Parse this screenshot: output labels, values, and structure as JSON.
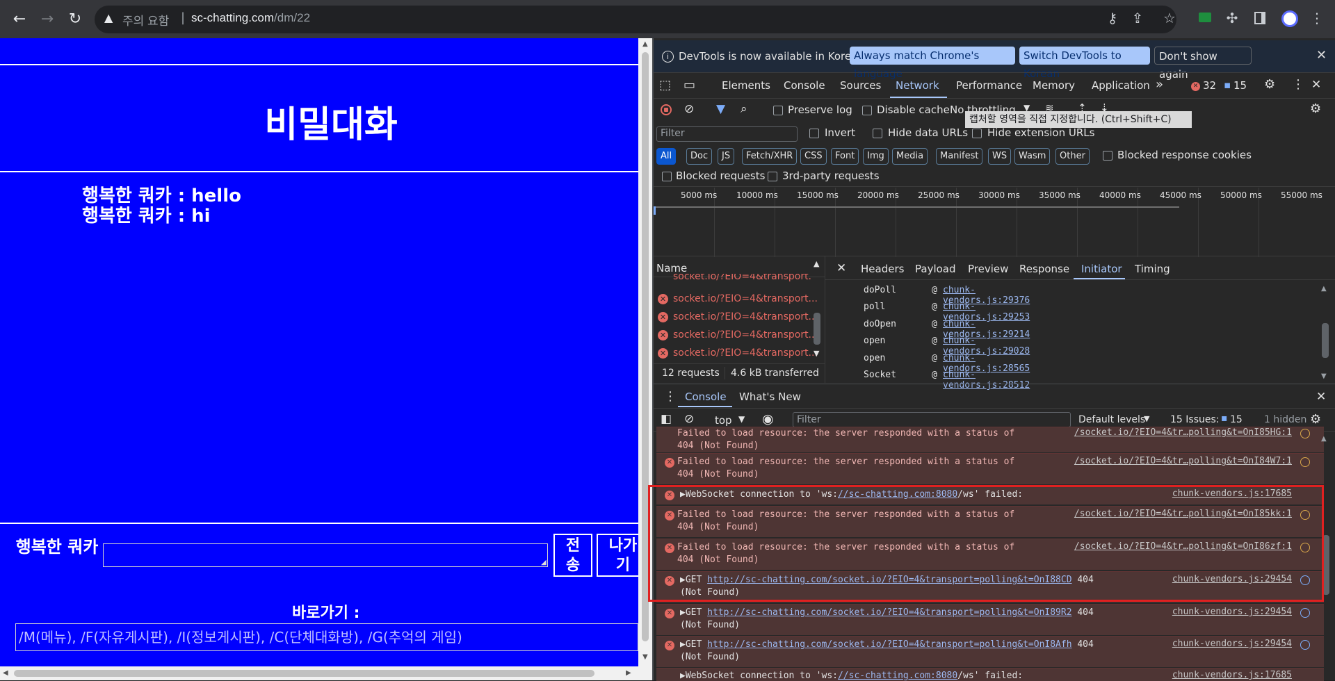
{
  "browser": {
    "security_warning": "주의 요함",
    "url_host": "sc-chatting.com",
    "url_path": "/dm/22"
  },
  "page": {
    "title": "비밀대화",
    "messages": [
      {
        "text": "행복한 쿼카 : hello"
      },
      {
        "text": "행복한 쿼카 : hi"
      }
    ],
    "nickname": "행복한 쿼카",
    "send_label": "전송",
    "exit_label": "나가기",
    "shortcut_label": "바로가기 :",
    "shortcut_text": "/M(메뉴), /F(자유게시판), /I(정보게시판), /C(단체대화방), /G(추억의 게임)"
  },
  "devtools": {
    "infobar": {
      "message": "DevTools is now available in Korean!",
      "btn_match": "Always match Chrome's language",
      "btn_switch": "Switch DevTools to Korean",
      "btn_dismiss": "Don't show again"
    },
    "tabs": [
      "Elements",
      "Console",
      "Sources",
      "Network",
      "Performance",
      "Memory",
      "Application"
    ],
    "error_count": "32",
    "issue_count": "15",
    "toolbar": {
      "preserve_log": "Preserve log",
      "disable_cache": "Disable cache",
      "throttling": "No throttling",
      "tooltip": "캡처할 영역을 직접 지정합니다. (Ctrl+Shift+C)"
    },
    "filter": {
      "placeholder": "Filter",
      "invert": "Invert",
      "hide_data_urls": "Hide data URLs",
      "hide_ext_urls": "Hide extension URLs",
      "blocked_cookies": "Blocked response cookies",
      "blocked_requests": "Blocked requests",
      "third_party": "3rd-party requests"
    },
    "types": [
      "All",
      "Doc",
      "JS",
      "Fetch/XHR",
      "CSS",
      "Font",
      "Img",
      "Media",
      "Manifest",
      "WS",
      "Wasm",
      "Other"
    ],
    "ticks": [
      "5000 ms",
      "10000 ms",
      "15000 ms",
      "20000 ms",
      "25000 ms",
      "30000 ms",
      "35000 ms",
      "40000 ms",
      "45000 ms",
      "50000 ms",
      "55000 ms"
    ],
    "name_header": "Name",
    "requests": [
      "socket.io/?EIO=4&transport...",
      "socket.io/?EIO=4&transport...",
      "socket.io/?EIO=4&transport...",
      "socket.io/?EIO=4&transport...",
      "socket.io/?EIO=4&transport..."
    ],
    "summary_requests": "12 requests",
    "summary_transferred": "4.6 kB transferred",
    "detail_tabs": [
      "Headers",
      "Payload",
      "Preview",
      "Response",
      "Initiator",
      "Timing"
    ],
    "stack": [
      {
        "fn": "doPoll",
        "at": "@",
        "src": "chunk-vendors.js:29376"
      },
      {
        "fn": "poll",
        "at": "@",
        "src": "chunk-vendors.js:29253"
      },
      {
        "fn": "doOpen",
        "at": "@",
        "src": "chunk-vendors.js:29214"
      },
      {
        "fn": "open",
        "at": "@",
        "src": "chunk-vendors.js:29028"
      },
      {
        "fn": "open",
        "at": "@",
        "src": "chunk-vendors.js:28565"
      },
      {
        "fn": "Socket",
        "at": "@",
        "src": "chunk-vendors.js:28512"
      }
    ],
    "drawer_tabs": [
      "Console",
      "What's New"
    ],
    "console_toolbar": {
      "context": "top",
      "filter_placeholder": "Filter",
      "levels": "Default levels",
      "issues_label": "15 Issues:",
      "issues_count": "15",
      "hidden": "1 hidden"
    },
    "console": {
      "r0_l1": "Failed to load resource: the server responded with a status of",
      "r0_l2": "404 (Not Found)",
      "r0_src": "/socket.io/?EIO=4&tr…polling&t=OnI85HG:1",
      "r1_l1": "Failed to load resource: the server responded with a status of",
      "r1_l2": "404 (Not Found)",
      "r1_src": "/socket.io/?EIO=4&tr…polling&t=OnI84W7:1",
      "r2_pre": "▶WebSocket connection to 'ws:",
      "r2_url": "//sc-chatting.com:8080",
      "r2_post": "/ws' failed:",
      "r2_src": "chunk-vendors.js:17685",
      "r3_l1": "Failed to load resource: the server responded with a status of",
      "r3_l2": "404 (Not Found)",
      "r3_src": "/socket.io/?EIO=4&tr…polling&t=OnI85kk:1",
      "r4_l1": "Failed to load resource: the server responded with a status of",
      "r4_l2": "404 (Not Found)",
      "r4_src": "/socket.io/?EIO=4&tr…polling&t=OnI86zf:1",
      "r5_pre": "▶GET ",
      "r5_url": "http://sc-chatting.com/socket.io/?EIO=4&transport=polling&t=OnI88CD",
      "r5_post": " 404",
      "r5_l2": "(Not Found)",
      "r5_src": "chunk-vendors.js:29454",
      "r6_pre": "▶GET ",
      "r6_url": "http://sc-chatting.com/socket.io/?EIO=4&transport=polling&t=OnI89R2",
      "r6_post": " 404",
      "r6_l2": "(Not Found)",
      "r6_src": "chunk-vendors.js:29454",
      "r7_pre": "▶GET ",
      "r7_url": "http://sc-chatting.com/socket.io/?EIO=4&transport=polling&t=OnI8Afh",
      "r7_post": " 404",
      "r7_l2": "(Not Found)",
      "r7_src": "chunk-vendors.js:29454",
      "r8_pre": "▶WebSocket connection to 'ws:",
      "r8_url": "//sc-chatting.com:8080",
      "r8_post": "/ws' failed:",
      "r8_src": "chunk-vendors.js:17685"
    }
  },
  "colors": {
    "page_bg": "#0000ff",
    "highlight_box": "#e02020",
    "error_red": "#e46962",
    "active_blue": "#7cacf8"
  },
  "icons": [
    "back-icon",
    "forward-icon",
    "reload-icon",
    "warning-icon",
    "key-icon",
    "share-icon",
    "star-icon",
    "extension-icon",
    "puzzle-icon",
    "sidepanel-icon",
    "profile-icon",
    "menu-icon"
  ]
}
